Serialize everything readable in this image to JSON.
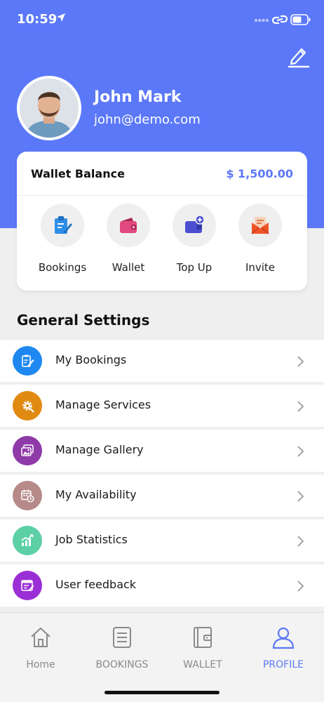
{
  "status_bar": {
    "time": "10:59"
  },
  "profile": {
    "name": "John Mark",
    "email": "john@demo.com"
  },
  "wallet": {
    "label": "Wallet Balance",
    "amount": "$ 1,500.00",
    "actions": [
      {
        "label": "Bookings",
        "icon": "clipboard-edit-icon"
      },
      {
        "label": "Wallet",
        "icon": "wallet-icon"
      },
      {
        "label": "Top Up",
        "icon": "wallet-add-icon"
      },
      {
        "label": "Invite",
        "icon": "envelope-icon"
      }
    ]
  },
  "settings": {
    "title": "General Settings",
    "items": [
      {
        "label": "My Bookings",
        "icon": "clipboard-edit-icon",
        "color": "#1e88f0"
      },
      {
        "label": "Manage Services",
        "icon": "gear-icon",
        "color": "#e08a12"
      },
      {
        "label": "Manage Gallery",
        "icon": "gallery-icon",
        "color": "#8e3aa8"
      },
      {
        "label": "My Availability",
        "icon": "calendar-clock-icon",
        "color": "#b78a8a"
      },
      {
        "label": "Job Statistics",
        "icon": "chart-icon",
        "color": "#5ccfa6"
      },
      {
        "label": "User feedback",
        "icon": "feedback-icon",
        "color": "#9b2fd6"
      }
    ]
  },
  "nav": {
    "items": [
      {
        "label": "Home",
        "icon": "home-icon"
      },
      {
        "label": "BOOKINGS",
        "icon": "list-icon"
      },
      {
        "label": "WALLET",
        "icon": "wallet-icon"
      },
      {
        "label": "PROFILE",
        "icon": "user-icon"
      }
    ],
    "active": "PROFILE"
  },
  "colors": {
    "primary": "#5b78f8",
    "background": "#efefef",
    "card": "#ffffff"
  }
}
